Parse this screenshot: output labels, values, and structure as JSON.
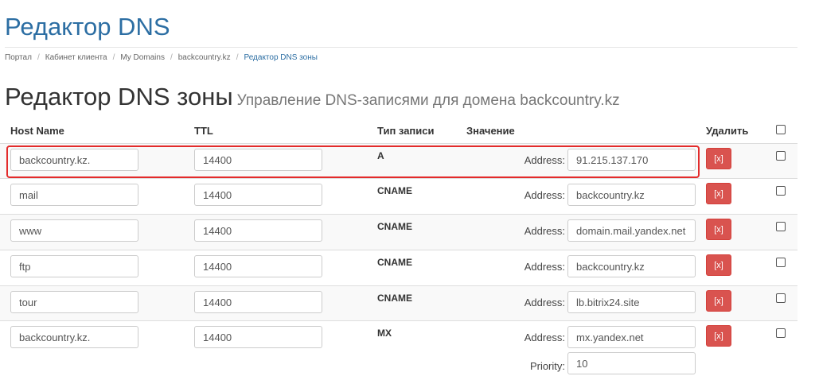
{
  "page": {
    "title": "Редактор DNS"
  },
  "breadcrumb": [
    {
      "label": "Портал"
    },
    {
      "label": "Кабинет клиента"
    },
    {
      "label": "My Domains"
    },
    {
      "label": "backcountry.kz"
    },
    {
      "label": "Редактор DNS зоны"
    }
  ],
  "zone": {
    "heading": "Редактор DNS зоны",
    "subheading": "Управление DNS-записями для домена backcountry.kz"
  },
  "table": {
    "headers": {
      "host": "Host Name",
      "ttl": "TTL",
      "type": "Тип записи",
      "value": "Значение",
      "delete": "Удалить"
    },
    "address_label": "Address:",
    "priority_label": "Priority:",
    "delete_button": "[x]",
    "rows": [
      {
        "host": "backcountry.kz.",
        "ttl": "14400",
        "type": "A",
        "address": "91.215.137.170"
      },
      {
        "host": "mail",
        "ttl": "14400",
        "type": "CNAME",
        "address": "backcountry.kz"
      },
      {
        "host": "www",
        "ttl": "14400",
        "type": "CNAME",
        "address": "domain.mail.yandex.net"
      },
      {
        "host": "ftp",
        "ttl": "14400",
        "type": "CNAME",
        "address": "backcountry.kz"
      },
      {
        "host": "tour",
        "ttl": "14400",
        "type": "CNAME",
        "address": "lb.bitrix24.site"
      },
      {
        "host": "backcountry.kz.",
        "ttl": "14400",
        "type": "MX",
        "address": "mx.yandex.net",
        "priority": "10"
      }
    ]
  },
  "colors": {
    "accent": "#2c6ea3",
    "delete_button": "#d9534f",
    "highlight": "#e32b2b"
  }
}
